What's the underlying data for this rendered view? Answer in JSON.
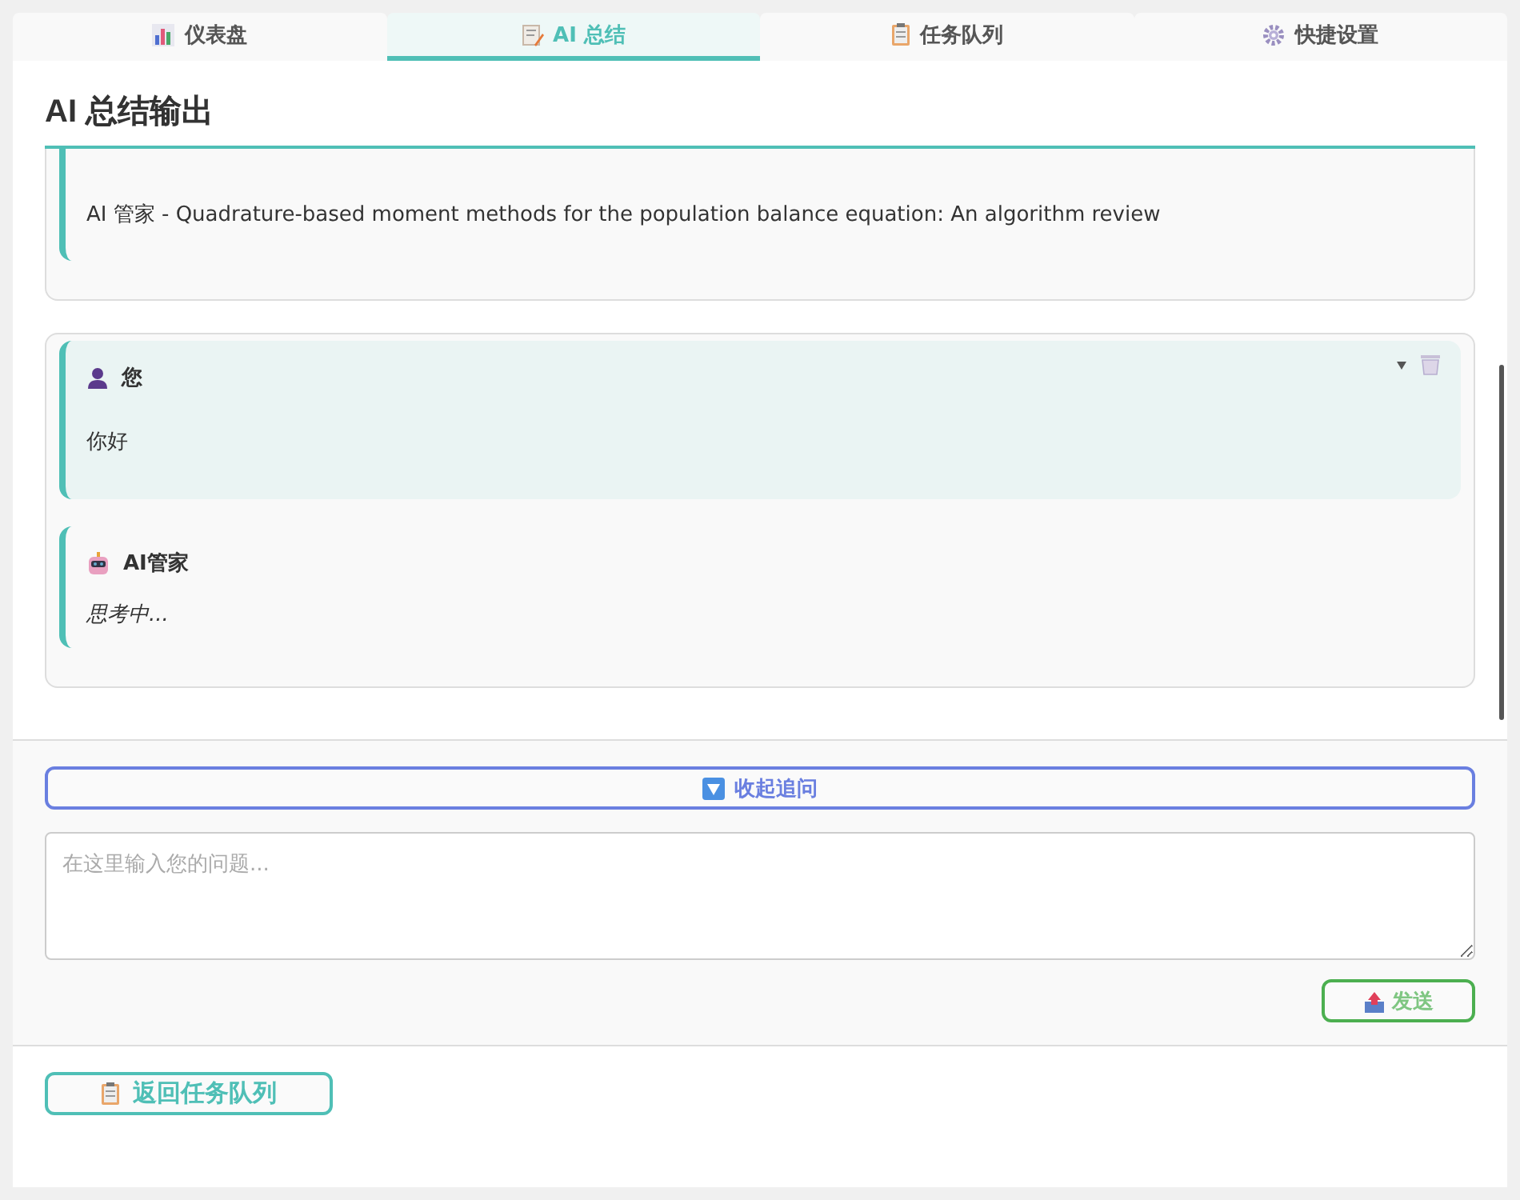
{
  "tabs": [
    {
      "label": "仪表盘",
      "selected": false
    },
    {
      "label": "AI 总结",
      "selected": true
    },
    {
      "label": "任务队列",
      "selected": false
    },
    {
      "label": "快捷设置",
      "selected": false
    }
  ],
  "panel_title": "AI 总结输出",
  "conversations": [
    {
      "messages": [
        {
          "kind": "ai_cut",
          "text": "AI 管家 - Quadrature-based moment methods for the population balance equation: An algorithm review",
          "italic": false
        }
      ]
    },
    {
      "messages": [
        {
          "kind": "user",
          "sender": "您",
          "text": "你好",
          "italic": false
        },
        {
          "kind": "ai",
          "sender": "AI管家",
          "text": "思考中...",
          "italic": true
        }
      ]
    }
  ],
  "followup": {
    "toggle_label": "收起追问",
    "placeholder": "在这里输入您的问题...",
    "send_label": "发送"
  },
  "back_button": "返回任务队列"
}
